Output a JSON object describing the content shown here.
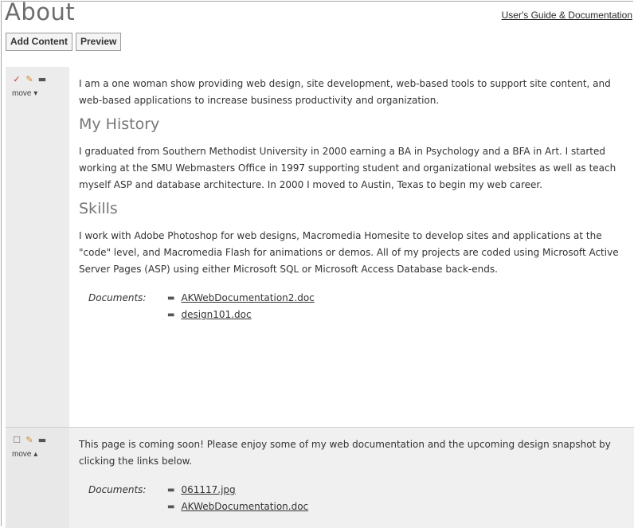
{
  "page": {
    "title": "About",
    "guide_link": "User's Guide & Documentation"
  },
  "toolbar": {
    "add_content_label": "Add Content",
    "preview_label": "Preview"
  },
  "icons": {
    "check": "check-icon",
    "edit": "pencil-icon",
    "delete": "trash-icon",
    "checkbox": "checkbox-icon"
  },
  "blocks": [
    {
      "move_label": "move ▾",
      "intro": "I am a one woman show providing web design, site development, web-based tools to support site content, and web-based applications to increase business productivity and organization.",
      "history_heading": "My History",
      "history_text": "I graduated from Southern Methodist University in 2000 earning a BA in Psychology and a BFA in Art. I started working at the SMU Webmasters Office in 1997 supporting student and organizational websites as well as teach myself ASP and database architecture. In 2000 I moved to Austin, Texas to begin my web career.",
      "skills_heading": "Skills",
      "skills_text": "I work with Adobe Photoshop for web designs, Macromedia Homesite to develop sites and applications at the \"code\" level, and Macromedia Flash for animations or demos. All of my projects are coded using Microsoft Active Server Pages (ASP) using either Microsoft SQL or Microsoft Access Database back-ends.",
      "documents_label": "Documents:",
      "documents": [
        "AKWebDocumentation2.doc",
        "design101.doc"
      ]
    },
    {
      "move_label": "move ▴",
      "intro": "This page is coming soon! Please enjoy some of my web documentation and the upcoming design snapshot by clicking the links below.",
      "documents_label": "Documents:",
      "documents": [
        "061117.jpg",
        "AKWebDocumentation.doc"
      ]
    }
  ]
}
